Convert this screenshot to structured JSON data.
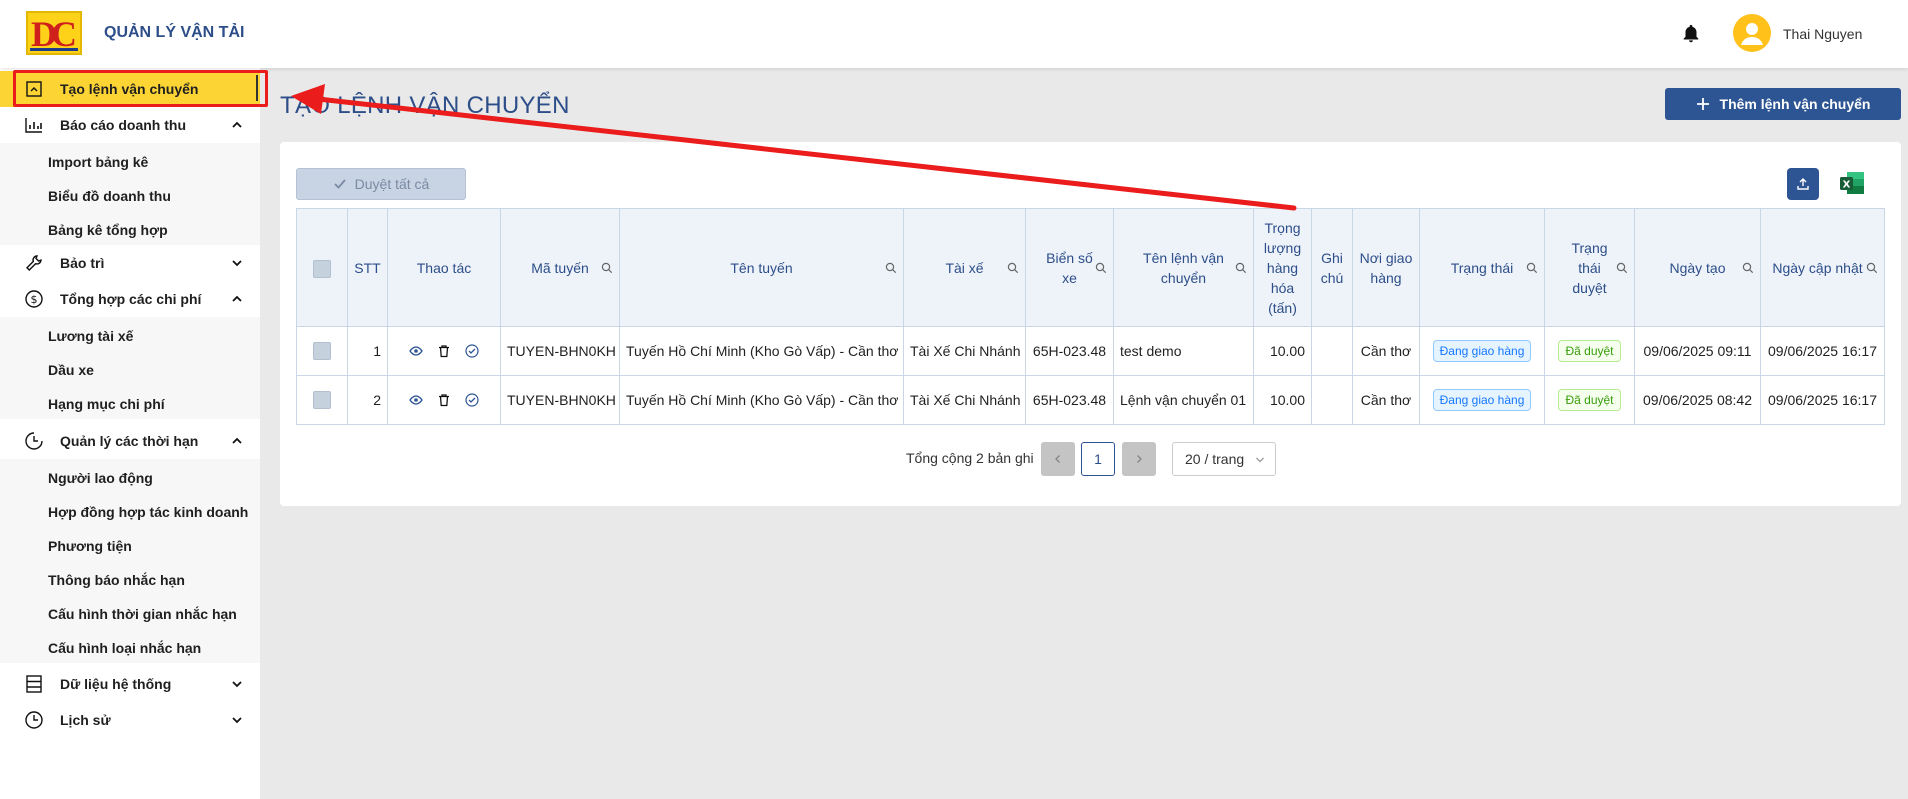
{
  "header": {
    "app_title": "QUẢN LÝ VẬN TẢI",
    "user_name": "Thai Nguyen"
  },
  "sidebar": {
    "items": [
      {
        "label": "Tạo lệnh vận chuyển",
        "icon": "export-icon"
      },
      {
        "label": "Báo cáo doanh thu",
        "icon": "chart-icon",
        "subitems": [
          "Import bảng kê",
          "Biểu đồ doanh thu",
          "Bảng kê tổng hợp"
        ]
      },
      {
        "label": "Bảo trì",
        "icon": "wrench-icon"
      },
      {
        "label": "Tổng hợp các chi phí",
        "icon": "dollar-icon",
        "subitems": [
          "Lương tài xế",
          "Dầu xe",
          "Hạng mục chi phí"
        ]
      },
      {
        "label": "Quản lý các thời hạn",
        "icon": "clock-icon",
        "subitems": [
          "Người lao động",
          "Hợp đồng hợp tác kinh doanh",
          "Phương tiện",
          "Thông báo nhắc hạn",
          "Cấu hình thời gian nhắc hạn",
          "Cấu hình loại nhắc hạn"
        ]
      },
      {
        "label": "Dữ liệu hệ thống",
        "icon": "database-icon"
      },
      {
        "label": "Lịch sử",
        "icon": "history-icon"
      }
    ]
  },
  "main": {
    "title": "TẠO LỆNH VẬN CHUYỂN",
    "add_button": "Thêm lệnh vận chuyển",
    "approve_all": "Duyệt tất cả",
    "columns": [
      "STT",
      "Thao tác",
      "Mã tuyến",
      "Tên tuyến",
      "Tài xế",
      "Biển số xe",
      "Tên lệnh vận chuyển",
      "Trọng lượng hàng hóa (tấn)",
      "Ghi chú",
      "Nơi giao hàng",
      "Trạng thái",
      "Trạng thái duyệt",
      "Ngày tạo",
      "Ngày cập nhật"
    ],
    "rows": [
      {
        "stt": "1",
        "ma_tuyen": "TUYEN-BHN0KH",
        "ten_tuyen": "Tuyến Hồ Chí Minh (Kho Gò Vấp) - Cần thơ",
        "tai_xe": "Tài Xế Chi Nhánh",
        "bien_so": "65H-023.48",
        "ten_lenh": "test demo",
        "trong_luong": "10.00",
        "ghi_chu": "",
        "noi_giao": "Cần thơ",
        "trang_thai": "Đang giao hàng",
        "duyet": "Đã duyệt",
        "ngay_tao": "09/06/2025 09:11",
        "ngay_cap_nhat": "09/06/2025 16:17"
      },
      {
        "stt": "2",
        "ma_tuyen": "TUYEN-BHN0KH",
        "ten_tuyen": "Tuyến Hồ Chí Minh (Kho Gò Vấp) - Cần thơ",
        "tai_xe": "Tài Xế Chi Nhánh",
        "bien_so": "65H-023.48",
        "ten_lenh": "Lệnh vận chuyển 01",
        "trong_luong": "10.00",
        "ghi_chu": "",
        "noi_giao": "Cần thơ",
        "trang_thai": "Đang giao hàng",
        "duyet": "Đã duyệt",
        "ngay_tao": "09/06/2025 08:42",
        "ngay_cap_nhat": "09/06/2025 16:17"
      }
    ],
    "pagination": {
      "total": "Tổng cộng 2 bản ghi",
      "current": "1",
      "page_size": "20 / trang"
    }
  },
  "colors": {
    "brand": "#2d5493",
    "active_menu": "#fcd535",
    "annotation": "#ea1c1c"
  }
}
